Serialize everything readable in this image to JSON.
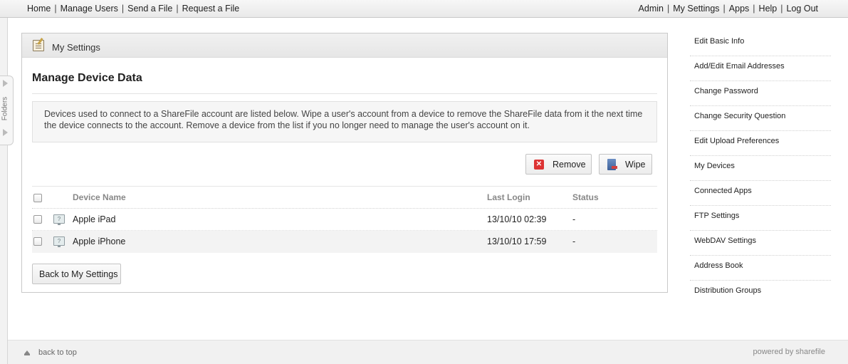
{
  "topnav": {
    "left": [
      "Home",
      "Manage Users",
      "Send a File",
      "Request a File"
    ],
    "right": [
      "Admin",
      "My Settings",
      "Apps",
      "Help",
      "Log Out"
    ],
    "separator": "|"
  },
  "folders_tab": {
    "label": "Folders"
  },
  "panel": {
    "header_title": "My Settings",
    "heading": "Manage Device Data",
    "info": "Devices used to connect to a ShareFile account are listed below. Wipe a user's account from a device to remove the ShareFile data from it the next time the device connects to the account. Remove a device from the list if you no longer need to manage the user's account on it.",
    "buttons": {
      "remove": "Remove",
      "wipe": "Wipe",
      "back": "Back to My Settings"
    },
    "table": {
      "columns": [
        "Device Name",
        "Last Login",
        "Status"
      ],
      "rows": [
        {
          "device": "Apple iPad",
          "last_login": "13/10/10 02:39",
          "status": "-"
        },
        {
          "device": "Apple iPhone",
          "last_login": "13/10/10 17:59",
          "status": "-"
        }
      ]
    }
  },
  "sidebar": {
    "items": [
      "Edit Basic Info",
      "Add/Edit Email Addresses",
      "Change Password",
      "Change Security Question",
      "Edit Upload Preferences",
      "My Devices",
      "Connected Apps",
      "FTP Settings",
      "WebDAV Settings",
      "Address Book",
      "Distribution Groups"
    ]
  },
  "footer": {
    "back_to_top": "back to top",
    "powered_by": "powered by sharefile"
  },
  "colors": {
    "remove_icon": "#dd3333",
    "device_icon": "#8f9ba0",
    "panel_border": "#c9c9c9"
  },
  "icons": {
    "settings": "settings-notepad-icon",
    "remove": "red-x-icon",
    "wipe": "wipe-device-icon",
    "device": "unknown-device-icon",
    "back_to_top": "up-arrow-icon"
  }
}
